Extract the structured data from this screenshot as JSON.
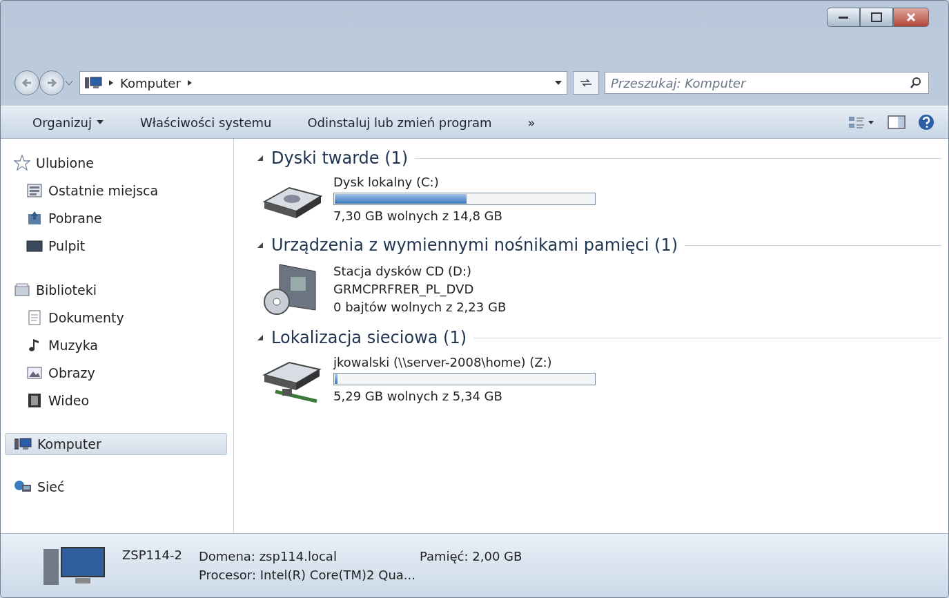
{
  "address": {
    "crumbs": [
      "Komputer"
    ]
  },
  "search": {
    "placeholder": "Przeszukaj: Komputer"
  },
  "toolbar": {
    "items": [
      {
        "label": "Organizuj",
        "kind": "menu"
      },
      {
        "label": "Właściwości systemu",
        "kind": "button"
      },
      {
        "label": "Odinstaluj lub zmień program",
        "kind": "button"
      },
      {
        "label": "»",
        "kind": "button"
      }
    ]
  },
  "sidebar": {
    "items": [
      {
        "label": "Ulubione",
        "selected": false,
        "children": [
          {
            "label": "Ostatnie miejsca",
            "selected": false
          },
          {
            "label": "Pobrane",
            "selected": false
          },
          {
            "label": "Pulpit",
            "selected": false
          }
        ]
      },
      {
        "label": "Biblioteki",
        "selected": false,
        "children": [
          {
            "label": "Dokumenty",
            "selected": false
          },
          {
            "label": "Muzyka",
            "selected": false
          },
          {
            "label": "Obrazy",
            "selected": false
          },
          {
            "label": "Wideo",
            "selected": false
          }
        ]
      },
      {
        "label": "Komputer",
        "selected": true
      },
      {
        "label": "Sieć",
        "selected": false
      }
    ]
  },
  "groups": [
    {
      "title": "Dyski twarde (1)",
      "expanded": true,
      "items": [
        {
          "kind": "disk",
          "name": "Dysk lokalny (C:)",
          "level": 0.507,
          "info": "7,30 GB wolnych z 14,8 GB"
        }
      ]
    },
    {
      "title": "Urządzenia z wymiennymi nośnikami pamięci (1)",
      "expanded": true,
      "items": [
        {
          "kind": "cd",
          "name": "Stacja dysków CD (D:)",
          "label": "GRMCPRFRER_PL_DVD",
          "info": "0 bajtów wolnych z 2,23 GB"
        }
      ]
    },
    {
      "title": "Lokalizacja sieciowa (1)",
      "expanded": true,
      "items": [
        {
          "kind": "network",
          "name": "jkowalski (\\\\server-2008\\home) (Z:)",
          "level": 0.01,
          "info": "5,29 GB wolnych z 5,34 GB"
        }
      ]
    }
  ],
  "details": {
    "name": "ZSP114-2",
    "domain": "Domena: zsp114.local",
    "memory": "Pamięć: 2,00 GB",
    "processor": "Procesor: Intel(R) Core(TM)2 Qua..."
  }
}
